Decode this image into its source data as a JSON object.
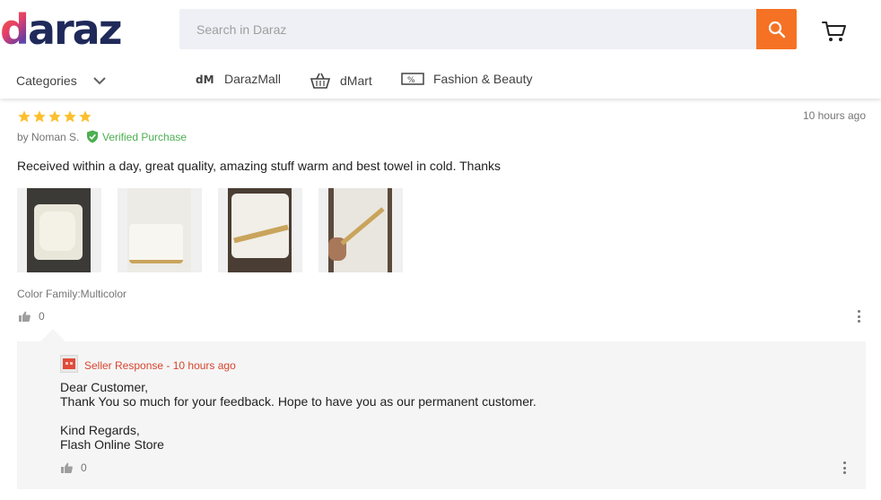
{
  "header": {
    "logo": "daraz",
    "search": {
      "placeholder": "Search in Daraz",
      "value": "",
      "button_icon": "search-icon"
    },
    "cart_icon": "cart-icon",
    "categories_label": "Categories",
    "nav": [
      {
        "label": "DarazMall",
        "icon": "darazmall-icon"
      },
      {
        "label": "dMart",
        "icon": "basket-icon"
      },
      {
        "label": "Fashion & Beauty",
        "icon": "discount-tag-icon"
      }
    ]
  },
  "review": {
    "rating": 5,
    "rating_max": 5,
    "author": "by Noman S.",
    "verified": "Verified Purchase",
    "time": "10 hours ago",
    "text": "Received within a day, great quality, amazing stuff warm and best towel in cold. Thanks",
    "photo_count": 4,
    "sku": "Color Family:Multicolor",
    "likes": "0"
  },
  "seller_response": {
    "title": "Seller Response - 10 hours ago",
    "line1": "Dear Customer,",
    "line2": "Thank You so much for your feedback. Hope to have you as our permanent customer.",
    "line3": "Kind Regards,",
    "line4": "Flash Online Store",
    "likes": "0"
  },
  "colors": {
    "brand_orange": "#f57224",
    "star": "#fbc02d",
    "verified": "#4caf50",
    "seller_red": "#d9452f",
    "response_bg": "#f5f5f5"
  }
}
